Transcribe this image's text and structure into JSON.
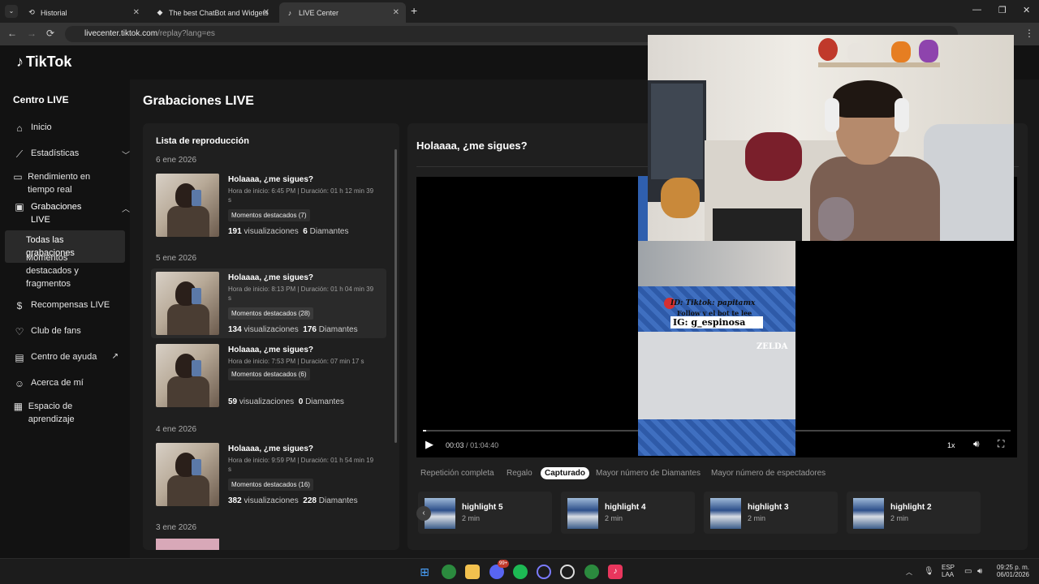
{
  "browser": {
    "tabs": [
      {
        "label": "Historial",
        "icon": "history-icon"
      },
      {
        "label": "The best ChatBot and Widgets",
        "icon": "site-icon"
      },
      {
        "label": "LIVE Center",
        "icon": "tiktok-icon"
      }
    ],
    "url_host": "livecenter.tiktok.com",
    "url_path": "/replay?lang=es"
  },
  "brand": {
    "name": "TikTok"
  },
  "sidebar": {
    "heading": "Centro LIVE",
    "items": [
      {
        "label": "Inicio",
        "icon": "home-icon"
      },
      {
        "label": "Estadísticas",
        "icon": "chart-icon"
      },
      {
        "label": "Rendimiento en tiempo real",
        "icon": "monitor-icon"
      },
      {
        "label": "Grabaciones LIVE",
        "icon": "recordings-icon"
      },
      {
        "label": "Recompensas LIVE",
        "icon": "dollar-icon"
      },
      {
        "label": "Club de fans",
        "icon": "heart-icon"
      },
      {
        "label": "Centro de ayuda",
        "icon": "book-icon"
      },
      {
        "label": "Acerca de mí",
        "icon": "person-icon"
      },
      {
        "label": "Espacio de aprendizaje",
        "icon": "learning-icon"
      }
    ],
    "sub_items": [
      "Todas las grabaciones",
      "Momentos destacados y fragmentos"
    ]
  },
  "main": {
    "title": "Grabaciones LIVE",
    "playlist": {
      "title": "Lista de reproducción",
      "dates": [
        "6 ene 2026",
        "5 ene 2026",
        "4 ene 2026",
        "3 ene 2026"
      ],
      "records": [
        {
          "title": "Holaaaa, ¿me sigues?",
          "meta": "Hora de inicio: 6:45 PM | Duración: 01 h 12 min 39 s",
          "badge": "Momentos destacados (7)",
          "views": "191",
          "views_label": "visualizaciones",
          "diamonds": "6",
          "diamonds_label": "Diamantes"
        },
        {
          "title": "Holaaaa, ¿me sigues?",
          "meta": "Hora de inicio: 8:13 PM | Duración: 01 h 04 min 39 s",
          "badge": "Momentos destacados (28)",
          "views": "134",
          "views_label": "visualizaciones",
          "diamonds": "176",
          "diamonds_label": "Diamantes"
        },
        {
          "title": "Holaaaa, ¿me sigues?",
          "meta": "Hora de inicio: 7:53 PM | Duración: 07 min 17 s",
          "badge": "Momentos destacados (6)",
          "views": "59",
          "views_label": "visualizaciones",
          "diamonds": "0",
          "diamonds_label": "Diamantes"
        },
        {
          "title": "Holaaaa, ¿me sigues?",
          "meta": "Hora de inicio: 9:59 PM | Duración: 01 h 54 min 19 s",
          "badge": "Momentos destacados (16)",
          "views": "382",
          "views_label": "visualizaciones",
          "diamonds": "228",
          "diamonds_label": "Diamantes"
        }
      ]
    },
    "player": {
      "title": "Holaaaa, ¿me sigues?",
      "current_time": "00:03",
      "total_time": "01:04:40",
      "progress": 0.001,
      "speed": "1x"
    },
    "filters": [
      "Repetición completa",
      "Regalo",
      "Capturado",
      "Mayor número de Diamantes",
      "Mayor número de espectadores"
    ],
    "highlights": [
      {
        "name": "highlight 5",
        "duration": "2 min"
      },
      {
        "name": "highlight 4",
        "duration": "2 min"
      },
      {
        "name": "highlight 3",
        "duration": "2 min"
      },
      {
        "name": "highlight 2",
        "duration": "2 min"
      }
    ]
  },
  "overlay": {
    "id_line": "ID: Tiktok: papitamx",
    "follow_line": "Follow y el bot te lee",
    "ig_line": "IG: g_espinosa",
    "game_title": "ZELDA"
  },
  "taskbar": {
    "lang": "ESP",
    "region": "LAA",
    "time": "09:25 p. m.",
    "date": "06/01/2026",
    "badge_count": "99+"
  }
}
